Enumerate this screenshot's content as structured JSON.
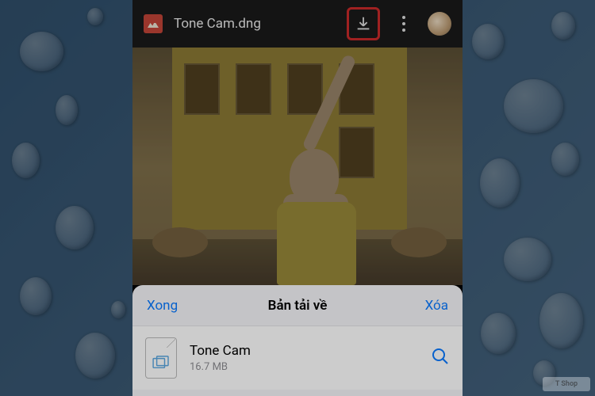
{
  "header": {
    "filename": "Tone Cam.dng"
  },
  "sheet": {
    "done_label": "Xong",
    "title": "Bản tải về",
    "delete_label": "Xóa"
  },
  "download": {
    "name": "Tone Cam",
    "size": "16.7 MB"
  },
  "watermark": "T Shop"
}
